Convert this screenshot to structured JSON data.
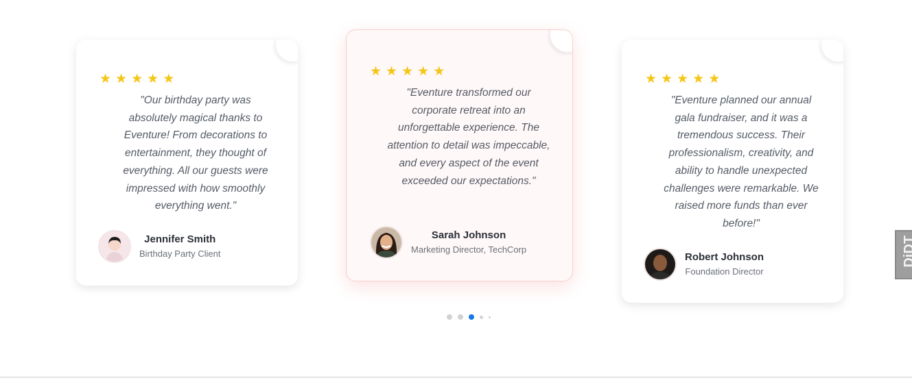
{
  "testimonials": [
    {
      "stars": "★★★★★",
      "quote": "\"Our birthday party was absolutely magical thanks to Eventure! From decorations to entertainment, they thought of everything. All our guests were impressed with how smoothly everything went.\"",
      "name": "Jennifer Smith",
      "role": "Birthday Party Client"
    },
    {
      "stars": "★★★★★",
      "quote": "\"Eventure transformed our corporate retreat into an unforgettable experience. The attention to detail was impeccable, and every aspect of the event exceeded our expectations.\"",
      "name": "Sarah Johnson",
      "role": "Marketing Director, TechCorp"
    },
    {
      "stars": "★★★★★",
      "quote": "\"Eventure planned our annual gala fundraiser, and it was a tremendous success. Their professionalism, creativity, and ability to handle unexpected challenges were remarkable. We raised more funds than ever before!\"",
      "name": "Robert Johnson",
      "role": "Foundation Director"
    }
  ],
  "pagination": {
    "count": 5,
    "active_index": 2
  },
  "colors": {
    "star": "#f5c518",
    "active_dot": "#1479e6",
    "inactive_dot": "#d2d2d2",
    "active_border": "#f7cfcf"
  },
  "edge_badge": {
    "text": "DiDT"
  }
}
